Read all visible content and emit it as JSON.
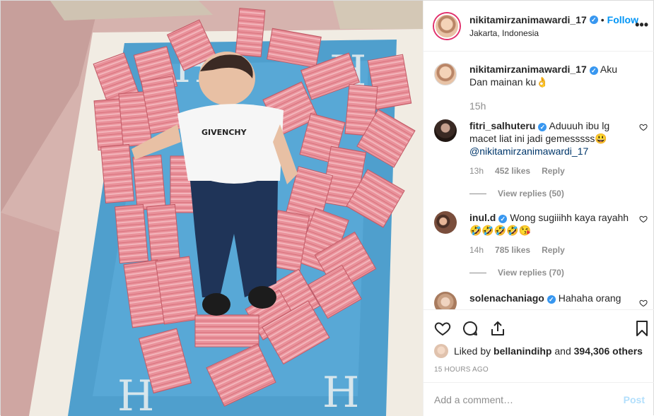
{
  "post": {
    "username": "nikitamirzanimawardi_17",
    "follow_label": "Follow",
    "separator": "•",
    "location": "Jakarta, Indonesia",
    "more_icon": "more-horizontal-icon"
  },
  "caption": {
    "username": "nikitamirzanimawardi_17",
    "text": "Aku Dan mainan ku👌",
    "time": "15h"
  },
  "comments": [
    {
      "username": "fitri_salhuteru",
      "text": "Aduuuh ibu lg macet liat ini jadi gemesssss😃",
      "mention": "@nikitamirzanimawardi_17",
      "time": "13h",
      "likes": "452 likes",
      "reply": "Reply",
      "view_replies": "View replies (50)"
    },
    {
      "username": "inul.d",
      "text": "Wong sugiiihh kaya rayahh 🤣🤣🤣🤣😘",
      "time": "14h",
      "likes": "785 likes",
      "reply": "Reply",
      "view_replies": "View replies (70)"
    },
    {
      "username": "solenachaniago",
      "text": "Hahaha orang"
    }
  ],
  "actions": {
    "icons": [
      "heart-icon",
      "comment-icon",
      "share-icon",
      "bookmark-icon"
    ]
  },
  "likes": {
    "prefix": "Liked by",
    "user": "bellanindihp",
    "conjunction": "and",
    "others": "394,306 others"
  },
  "timestamp": "15 HOURS AGO",
  "add_comment": {
    "placeholder": "Add a comment…",
    "post_label": "Post"
  },
  "colors": {
    "link_blue": "#0095f6",
    "verified_blue": "#3897f0",
    "post_disabled": "#b2dffc",
    "muted": "#8e8e8e"
  }
}
